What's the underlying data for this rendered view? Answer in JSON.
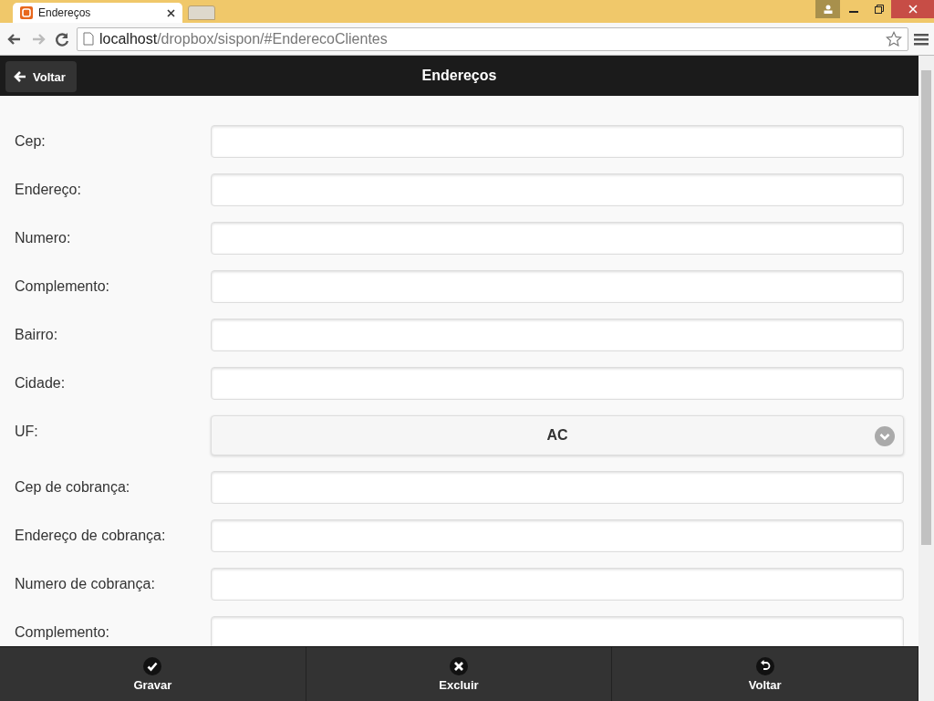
{
  "browser": {
    "tab_title": "Endereços",
    "url_host": "localhost",
    "url_path": "/dropbox/sispon/#EnderecoClientes"
  },
  "header": {
    "back_button": "Voltar",
    "title": "Endereços"
  },
  "fields": [
    {
      "kind": "text",
      "label": "Cep:"
    },
    {
      "kind": "text",
      "label": "Endereço:"
    },
    {
      "kind": "text",
      "label": "Numero:"
    },
    {
      "kind": "text",
      "label": "Complemento:"
    },
    {
      "kind": "text",
      "label": "Bairro:"
    },
    {
      "kind": "text",
      "label": "Cidade:"
    },
    {
      "kind": "select",
      "label": "UF:",
      "value": "AC"
    },
    {
      "kind": "text",
      "label": "Cep de cobrança:"
    },
    {
      "kind": "text",
      "label": "Endereço de cobrança:"
    },
    {
      "kind": "text",
      "label": "Numero de cobrança:"
    },
    {
      "kind": "text",
      "label": "Complemento:"
    }
  ],
  "footer": [
    {
      "kind": "save",
      "label": "Gravar"
    },
    {
      "kind": "delete",
      "label": "Excluir"
    },
    {
      "kind": "back",
      "label": "Voltar"
    }
  ]
}
